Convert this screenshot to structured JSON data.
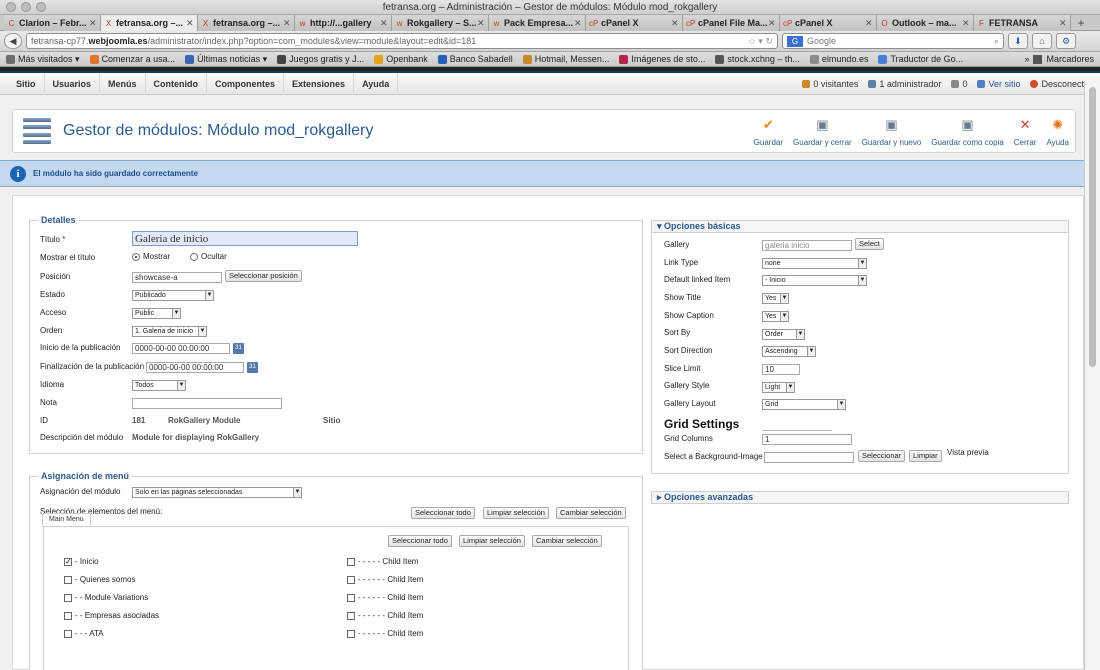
{
  "window": {
    "title": "fetransa.org – Administración – Gestor de módulos: Módulo mod_rokgallery"
  },
  "tabs": [
    {
      "label": "Clarion – Febr...",
      "icon": "C"
    },
    {
      "label": "fetransa.org –...",
      "icon": "X",
      "active": true
    },
    {
      "label": "fetransa.org –...",
      "icon": "X"
    },
    {
      "label": "http://...gallery",
      "icon": "w"
    },
    {
      "label": "Rokgallery – S...",
      "icon": "w"
    },
    {
      "label": "Pack Empresa...",
      "icon": "w"
    },
    {
      "label": "cPanel X",
      "icon": "cP"
    },
    {
      "label": "cPanel File Ma...",
      "icon": "cP"
    },
    {
      "label": "cPanel X",
      "icon": "cP"
    },
    {
      "label": "Outlook – ma...",
      "icon": "O"
    },
    {
      "label": "FETRANSA",
      "icon": "F"
    }
  ],
  "nav": {
    "url_prefix": "fetransa-cp77.",
    "url_domain": "webjoomla.es",
    "url_rest": "/administrator/index.php?option=com_modules&view=module&layout=edit&id=181",
    "search_placeholder": "Google"
  },
  "bookmarks": [
    {
      "label": "Más visitados ▾",
      "color": "#6d6d6d"
    },
    {
      "label": "Comenzar a usa...",
      "color": "#e0762b"
    },
    {
      "label": "Últimas noticias ▾",
      "color": "#3c66b5"
    },
    {
      "label": "Juegos gratis y J...",
      "color": "#444444"
    },
    {
      "label": "Openbank",
      "color": "#e0a21b"
    },
    {
      "label": "Banco Sabadell",
      "color": "#2a5fb7"
    },
    {
      "label": "Hotmail, Messen...",
      "color": "#c9882a"
    },
    {
      "label": "Imágenes de sto...",
      "color": "#b3264a"
    },
    {
      "label": "stock.xchng – th...",
      "color": "#555555"
    },
    {
      "label": "elmundo.es",
      "color": "#8a8a8a"
    },
    {
      "label": "Traductor de Go...",
      "color": "#4a7fd8"
    }
  ],
  "bookmarks_right": "Marcadores",
  "admin_menu": [
    "Sitio",
    "Usuarios",
    "Menús",
    "Contenido",
    "Componentes",
    "Extensiones",
    "Ayuda"
  ],
  "status": {
    "visitors": "0 visitantes",
    "admins": "1 administrador",
    "messages": "0",
    "view_site": "Ver sitio",
    "logout": "Desconectar"
  },
  "page_title": "Gestor de módulos: Módulo mod_rokgallery",
  "actions": [
    {
      "label": "Guardar",
      "color": "#e38a1d",
      "icon": "✔"
    },
    {
      "label": "Guardar y cerrar",
      "color": "#6a7a8e",
      "icon": "▣"
    },
    {
      "label": "Guardar y nuevo",
      "color": "#6a7a8e",
      "icon": "▣"
    },
    {
      "label": "Guardar como copia",
      "color": "#6a7a8e",
      "icon": "▣"
    },
    {
      "label": "Cerrar",
      "color": "#d9432a",
      "icon": "✕"
    },
    {
      "label": "Ayuda",
      "color": "#e3731d",
      "icon": "✺"
    }
  ],
  "message": "El módulo ha sido guardado correctamente",
  "details": {
    "legend": "Detalles",
    "title_label": "Título",
    "title_value": "Galeria de inicio",
    "show_title_label": "Mostrar el título",
    "show_option": "Mostrar",
    "hide_option": "Ocultar",
    "position_label": "Posición",
    "position_value": "showcase-a",
    "position_button": "Seleccionar posición",
    "state_label": "Estado",
    "state_value": "Publicado",
    "access_label": "Acceso",
    "access_value": "Public",
    "order_label": "Orden",
    "order_value": "1. Galeria de inicio",
    "publish_up_label": "Inicio de la publicación",
    "publish_up_value": "0000-00-00 00:00:00",
    "publish_down_label": "Finalización de la publicación",
    "publish_down_value": "0000-00-00 00:00:00",
    "language_label": "Idioma",
    "language_value": "Todos",
    "note_label": "Nota",
    "note_value": "",
    "id_label": "ID",
    "id_value": "181",
    "module_name": "RokGallery Module",
    "client": "Sitio",
    "desc_label": "Descripción del módulo",
    "desc_value": "Module for displaying RokGallery"
  },
  "basic": {
    "header": "Opciones básicas",
    "gallery_label": "Gallery",
    "gallery_value": "galeria inicio",
    "gallery_button": "Select",
    "link_type_label": "Link Type",
    "link_type_value": "none",
    "default_linked_label": "Default linked Item",
    "default_linked_value": "- Inicio",
    "show_title_label": "Show Title",
    "show_title_value": "Yes",
    "show_caption_label": "Show Caption",
    "show_caption_value": "Yes",
    "sort_by_label": "Sort By",
    "sort_by_value": "Order",
    "sort_dir_label": "Sort Direction",
    "sort_dir_value": "Ascending",
    "slice_limit_label": "Slice Limit",
    "slice_limit_value": "10",
    "gallery_style_label": "Gallery Style",
    "gallery_style_value": "Light",
    "gallery_layout_label": "Gallery Layout",
    "gallery_layout_value": "Grid",
    "grid_settings": "Grid Settings",
    "grid_columns_label": "Grid Columns",
    "grid_columns_value": "1",
    "bg_image_label": "Select a Background-Image",
    "bg_select_button": "Seleccionar",
    "bg_clear_button": "Limpiar",
    "preview_label": "Vista previa"
  },
  "advanced": {
    "header": "Opciones avanzadas"
  },
  "assignment": {
    "legend": "Asignación de menú",
    "assign_label": "Asignación del módulo",
    "assign_value": "Solo en las páginas seleccionadas",
    "selection_label": "Selección de elementos del menú:",
    "select_all": "Seleccionar todo",
    "clear_selection": "Limpiar selección",
    "toggle_selection": "Cambiar selección",
    "menu_tab": "Main Menu",
    "left_items": [
      {
        "label": "- Inicio",
        "checked": true
      },
      {
        "label": "- Quienes somos",
        "checked": false
      },
      {
        "label": "- - Module Variations",
        "checked": false
      },
      {
        "label": "- - Empresas asociadas",
        "checked": false
      },
      {
        "label": "- - - ATA",
        "checked": false
      }
    ],
    "right_items": [
      {
        "label": "- - - - - Child Item",
        "checked": false
      },
      {
        "label": "- - - - - - Child Item",
        "checked": false
      },
      {
        "label": "- - - - - - Child Item",
        "checked": false
      },
      {
        "label": "- - - - - - Child Item",
        "checked": false
      },
      {
        "label": "- - - - - - Child Item",
        "checked": false
      }
    ]
  }
}
